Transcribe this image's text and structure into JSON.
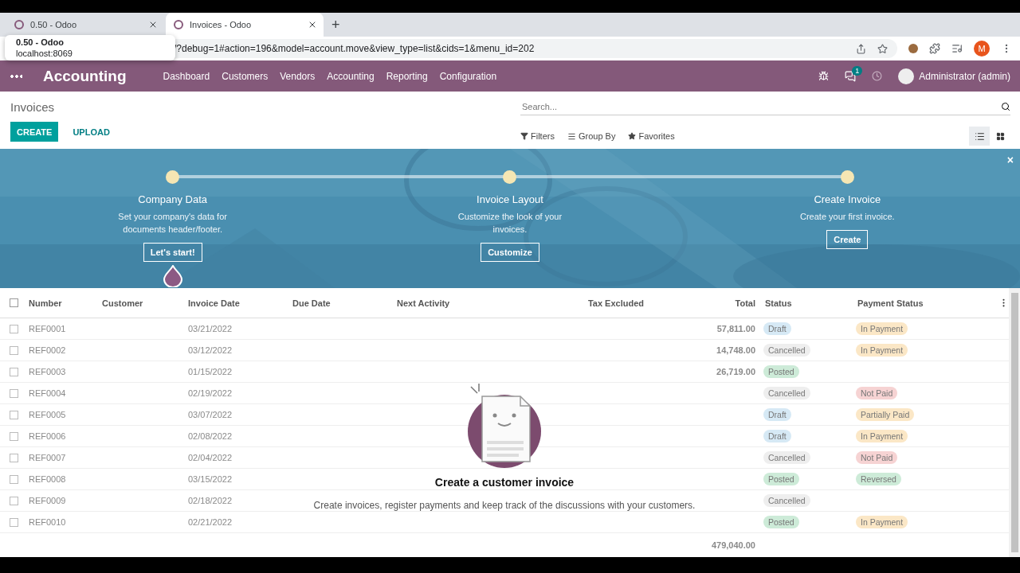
{
  "browser": {
    "tabs": [
      {
        "title": "0.50 - Odoo",
        "selected": false
      },
      {
        "title": "Invoices - Odoo",
        "selected": true
      }
    ],
    "new_tab": "+",
    "tooltip": {
      "title": "0.50 - Odoo",
      "url": "localhost:8069"
    },
    "address": "/?debug=1#action=196&model=account.move&view_type=list&cids=1&menu_id=202",
    "profile_initial": "M"
  },
  "navbar": {
    "app": "Accounting",
    "menu": [
      "Dashboard",
      "Customers",
      "Vendors",
      "Accounting",
      "Reporting",
      "Configuration"
    ],
    "messages_count": "1",
    "user": "Administrator (admin)"
  },
  "control_panel": {
    "title": "Invoices",
    "buttons": [
      "CREATE",
      "UPLOAD"
    ],
    "search": {
      "placeholder": "Search..."
    },
    "filters": [
      "Filters",
      "Group By",
      "Favorites"
    ],
    "views": [
      {
        "kind": "list",
        "selected": true
      },
      {
        "kind": "kanban",
        "selected": false
      }
    ]
  },
  "onboarding": {
    "close": "×",
    "steps": [
      {
        "title": "Company Data",
        "text": "Set your company's data for documents header/footer.",
        "button": "Let's start!",
        "current": true
      },
      {
        "title": "Invoice Layout",
        "text": "Customize the look of your invoices.",
        "button": "Customize",
        "current": false
      },
      {
        "title": "Create Invoice",
        "text": "Create your first invoice.",
        "button": "Create",
        "current": false
      }
    ]
  },
  "table": {
    "all_checked": false,
    "columns": [
      "Number",
      "Customer",
      "Invoice Date",
      "Due Date",
      "Next Activity",
      "Tax Excluded",
      "Total",
      "Status",
      "Payment Status"
    ],
    "rows": [
      {
        "checked": false,
        "number": "REF0001",
        "date": "03/21/2022",
        "total": "57,811.00",
        "status": {
          "label": "Draft",
          "color": "#d6e9f5"
        },
        "payment": {
          "label": "In Payment",
          "color": "#fbe7c6"
        }
      },
      {
        "checked": false,
        "number": "REF0002",
        "date": "03/12/2022",
        "total": "14,748.00",
        "status": {
          "label": "Cancelled",
          "color": "#eeeeee"
        },
        "payment": {
          "label": "In Payment",
          "color": "#fbe7c6"
        }
      },
      {
        "checked": false,
        "number": "REF0003",
        "date": "01/15/2022",
        "total": "26,719.00",
        "status": {
          "label": "Posted",
          "color": "#cdebd8"
        }
      },
      {
        "checked": false,
        "number": "REF0004",
        "date": "02/19/2022",
        "status": {
          "label": "Cancelled",
          "color": "#eeeeee"
        },
        "payment": {
          "label": "Not Paid",
          "color": "#f6d3d3"
        }
      },
      {
        "checked": false,
        "number": "REF0005",
        "date": "03/07/2022",
        "status": {
          "label": "Draft",
          "color": "#d6e9f5"
        },
        "payment": {
          "label": "Partially Paid",
          "color": "#fbe7c6"
        }
      },
      {
        "checked": false,
        "number": "REF0006",
        "date": "02/08/2022",
        "status": {
          "label": "Draft",
          "color": "#d6e9f5"
        },
        "payment": {
          "label": "In Payment",
          "color": "#fbe7c6"
        }
      },
      {
        "checked": false,
        "number": "REF0007",
        "date": "02/04/2022",
        "status": {
          "label": "Cancelled",
          "color": "#eeeeee"
        },
        "payment": {
          "label": "Not Paid",
          "color": "#f6d3d3"
        }
      },
      {
        "checked": false,
        "number": "REF0008",
        "date": "03/15/2022",
        "status": {
          "label": "Posted",
          "color": "#cdebd8"
        },
        "payment": {
          "label": "Reversed",
          "color": "#cdebd8"
        }
      },
      {
        "checked": false,
        "number": "REF0009",
        "date": "02/18/2022",
        "status": {
          "label": "Cancelled",
          "color": "#eeeeee"
        }
      },
      {
        "checked": false,
        "number": "REF0010",
        "date": "02/21/2022",
        "status": {
          "label": "Posted",
          "color": "#cdebd8"
        },
        "payment": {
          "label": "In Payment",
          "color": "#fbe7c6"
        }
      }
    ],
    "footer_total": "479,040.00"
  },
  "empty_state": {
    "title": "Create a customer invoice",
    "text": "Create invoices, register payments and keep track of the discussions with your customers."
  }
}
